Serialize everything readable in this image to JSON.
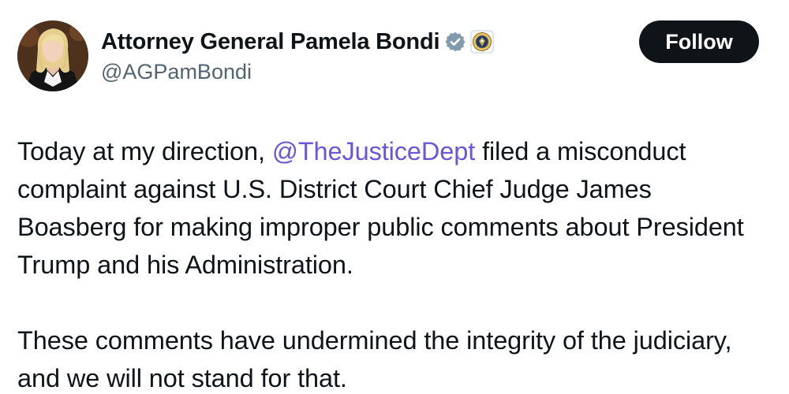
{
  "author": {
    "display_name": "Attorney General Pamela Bondi",
    "handle": "@AGPamBondi",
    "verified_icon": "verified-badge-icon",
    "affiliation_icon": "doj-seal-icon"
  },
  "follow_button": {
    "label": "Follow"
  },
  "tweet": {
    "paragraph_1": {
      "before_mention": "Today at my direction, ",
      "mention": "@TheJusticeDept",
      "after_mention": " filed a misconduct complaint against U.S. District Court Chief Judge James Boasberg for making improper public comments about President Trump and his Administration."
    },
    "paragraph_2": "These comments have undermined the integrity of the judiciary, and we will not stand for that."
  },
  "colors": {
    "text": "#0f1419",
    "secondary_text": "#536471",
    "mention": "#6d55d6",
    "verified_badge": "#829aab",
    "follow_bg": "#0f1419"
  }
}
